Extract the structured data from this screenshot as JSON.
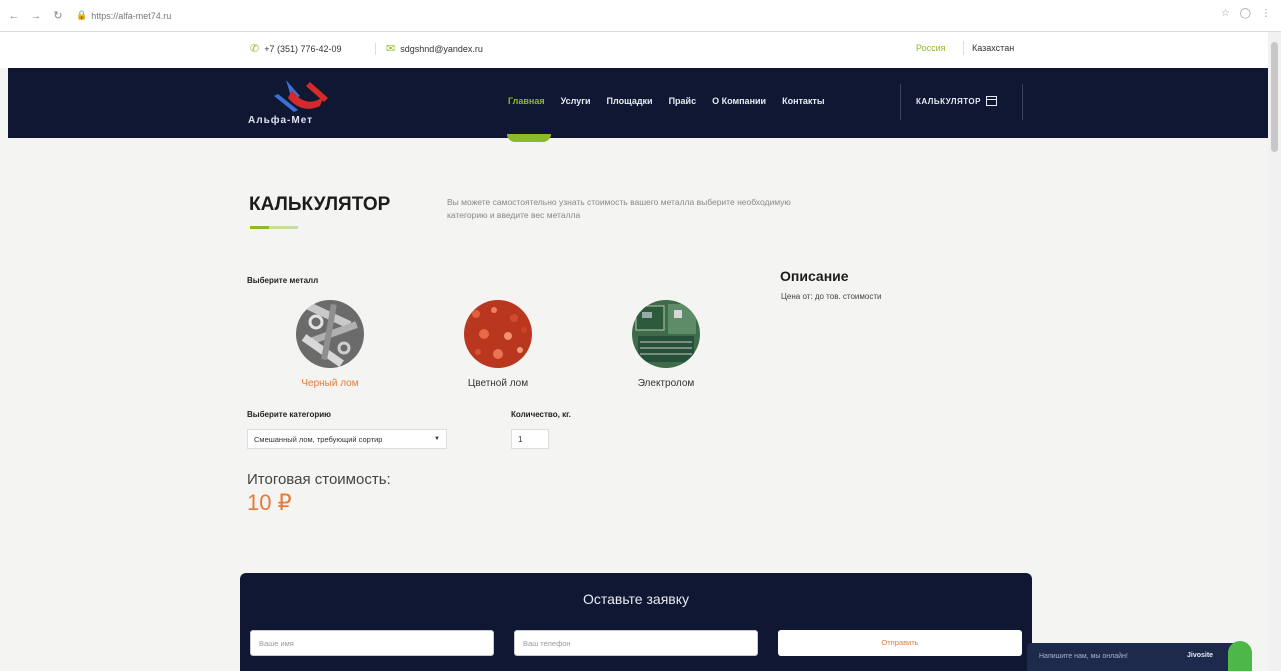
{
  "browser": {
    "url": "https://alfa-met74.ru"
  },
  "contacts": {
    "phone": "+7 (351) 776-42-09",
    "email": "sdgshnd@yandex.ru"
  },
  "regions": {
    "active": "Россия",
    "other": "Казахстан"
  },
  "logo": {
    "text": "Альфа-Мет"
  },
  "nav": {
    "items": [
      "Главная",
      "Услуги",
      "Площадки",
      "Прайс",
      "О Компании",
      "Контакты"
    ],
    "calculator": "КАЛЬКУЛЯТОР"
  },
  "calculator": {
    "title": "КАЛЬКУЛЯТОР",
    "intro": "Вы можете самостоятельно узнать стоимость вашего металла выберите необходимую категорию и введите вес металла",
    "metal_label": "Выберите металл",
    "metals": [
      "Черный лом",
      "Цветной лом",
      "Электролом"
    ],
    "description_title": "Описание",
    "description_text": "Цена от: до тов. стоимости",
    "category_label": "Выберите категорию",
    "category_value": "Смешанный лом, требующий сортир",
    "quantity_label": "Количество, кг.",
    "quantity_value": "1",
    "total_label": "Итоговая стоимость:",
    "total_value": "10 ₽"
  },
  "request": {
    "title": "Оставьте заявку",
    "name_placeholder": "Ваше имя",
    "phone_placeholder": "Ваш телефон",
    "submit": "Отправить"
  },
  "chat": {
    "text": "Напишите нам, мы онлайн!",
    "button": "Jivosite"
  },
  "colors": {
    "header": "#0f1733",
    "accent_green": "#8dbb25",
    "accent_orange": "#e87a37"
  }
}
